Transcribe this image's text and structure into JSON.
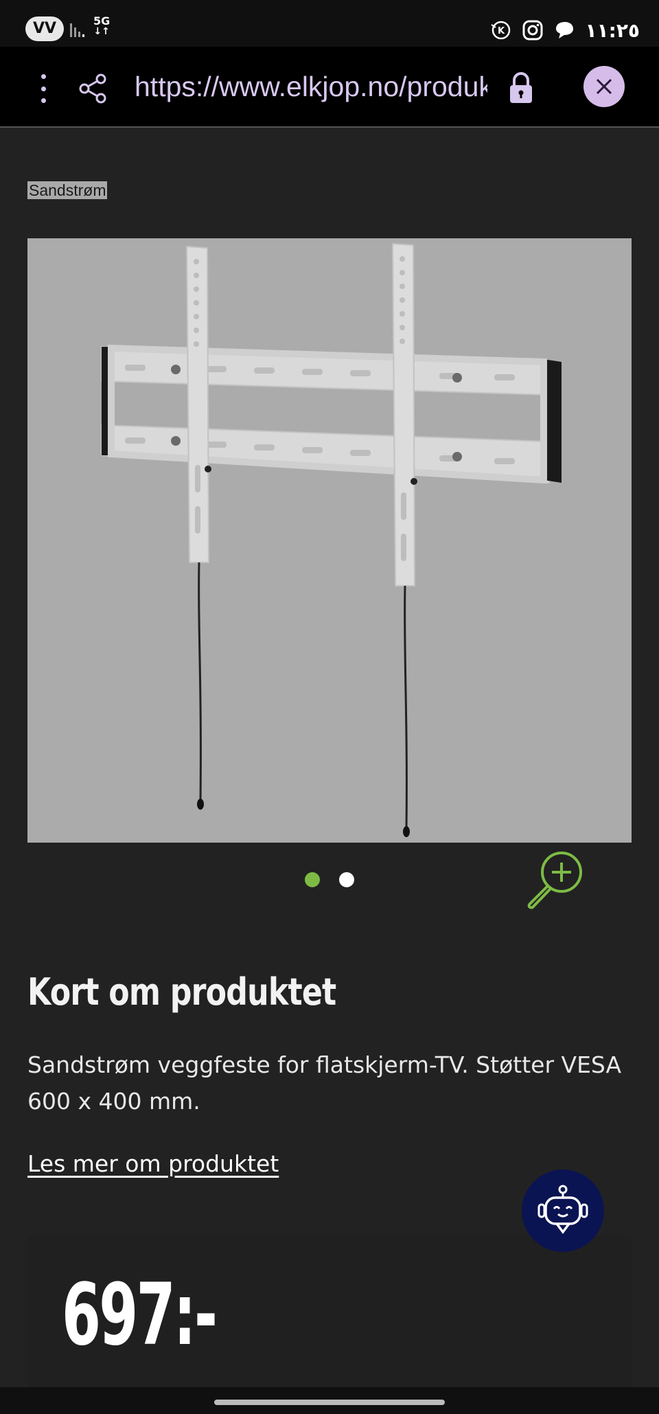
{
  "status_bar": {
    "pill_text": "VV",
    "network": "5G",
    "time": "١١:٢٥",
    "icons": [
      "signal-icon",
      "kaspersky-icon",
      "instagram-icon",
      "chat-bubble-icon"
    ]
  },
  "browser": {
    "url": "https://www.elkjop.no/produkt/tv-lyd-og-smarte-hjem/tv-tilbehor",
    "menu_icon": "more-vert-icon",
    "share_icon": "share-icon",
    "lock_icon": "lock-icon",
    "close_icon": "close-icon"
  },
  "product": {
    "brand": "Sandstrøm",
    "image_alt": "TV wall mount",
    "carousel": {
      "count": 2,
      "active_index": 0
    },
    "zoom_icon": "zoom-in-icon"
  },
  "info": {
    "title": "Kort om produktet",
    "description": "Sandstrøm veggfeste for flatskjerm-TV. Støtter VESA 600 x 400 mm.",
    "read_more": "Les mer om produktet"
  },
  "chat": {
    "icon": "robot-icon"
  },
  "price": {
    "value": "697:-"
  },
  "colors": {
    "accent_green": "#7dbb45",
    "url_text": "#d8c8f0",
    "close_button_bg": "#d6bde9",
    "chat_button_bg": "#0b1452",
    "page_bg": "#222222"
  }
}
